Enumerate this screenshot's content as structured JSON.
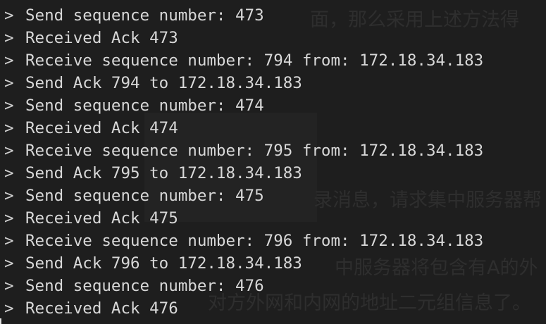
{
  "prompt_symbol": ">",
  "background_text": [
    "面，那么采用上述方法得",
    "录消息，请求集中服务器帮",
    "中服务器将包含有A的外",
    "对方外网和内网的地址二元组信息了。"
  ],
  "lines": [
    "Send sequence number: 473",
    "Received Ack 473",
    "Receive sequence number: 794 from: 172.18.34.183",
    "Send Ack 794 to 172.18.34.183",
    "Send sequence number: 474",
    "Received Ack 474",
    "Receive sequence number: 795 from: 172.18.34.183",
    "Send Ack 795 to 172.18.34.183",
    "Send sequence number: 475",
    "Received Ack 475",
    "Receive sequence number: 796 from: 172.18.34.183",
    "Send Ack 796 to 172.18.34.183",
    "Send sequence number: 476",
    "Received Ack 476"
  ]
}
